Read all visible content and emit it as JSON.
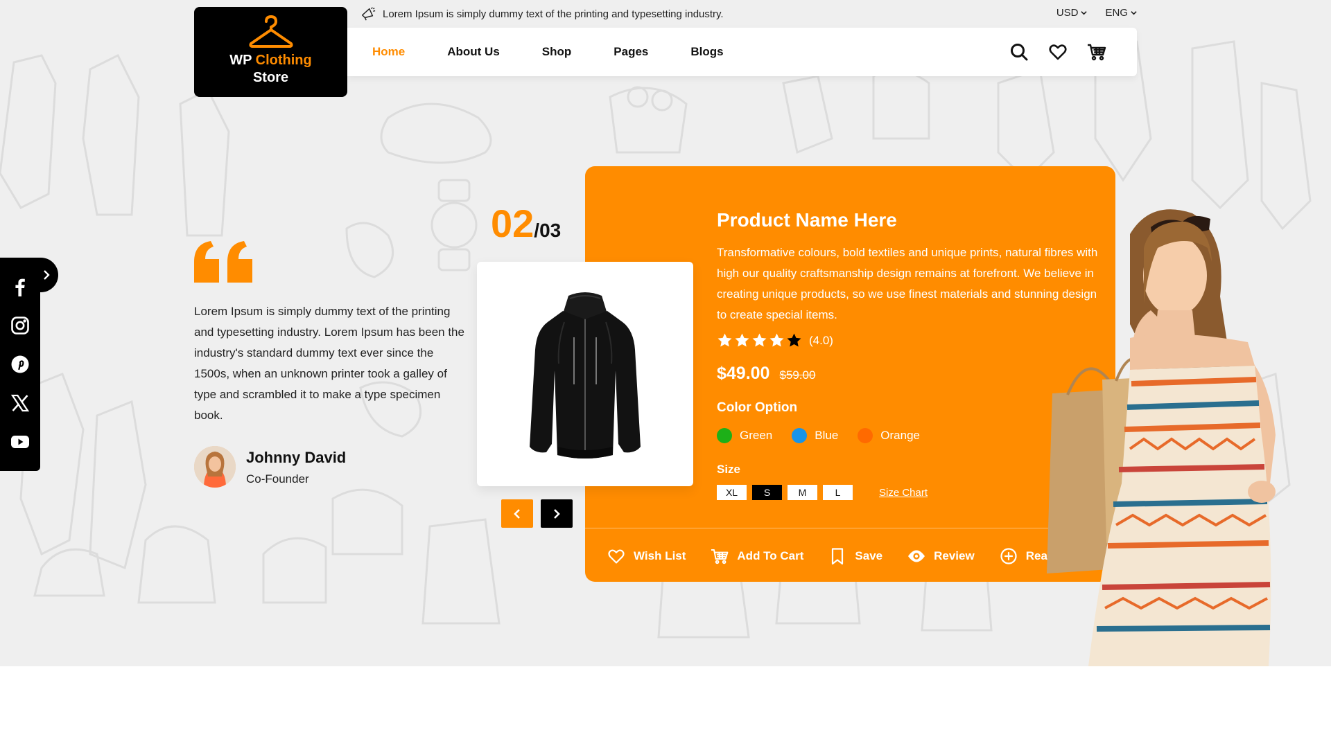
{
  "brand": {
    "line1_white": "WP",
    "line1_orange": "Clothing",
    "line2": "Store"
  },
  "topbar": {
    "announcement": "Lorem Ipsum is simply dummy text of the printing and typesetting industry.",
    "currency": "USD",
    "language": "ENG"
  },
  "nav": {
    "items": [
      {
        "label": "Home",
        "active": true
      },
      {
        "label": "About Us"
      },
      {
        "label": "Shop"
      },
      {
        "label": "Pages"
      },
      {
        "label": "Blogs"
      }
    ],
    "icons": [
      "search-icon",
      "heart-icon",
      "cart-icon"
    ]
  },
  "social": [
    "facebook-icon",
    "instagram-icon",
    "pinterest-icon",
    "x-icon",
    "youtube-icon"
  ],
  "testimonial": {
    "text": "Lorem Ipsum is simply dummy text of the printing and typesetting industry. Lorem Ipsum has been the industry's standard dummy text ever since the 1500s, when an unknown printer took a galley of type and scrambled it to make a type specimen book.",
    "author": "Johnny David",
    "role": "Co-Founder"
  },
  "slider": {
    "current": "02",
    "total": "/03"
  },
  "product": {
    "name": "Product Name Here",
    "description": "Transformative colours, bold textiles and unique prints, natural fibres with high our quality craftsmanship design remains at forefront. We believe in creating unique products, so we use finest materials and stunning design to create special items.",
    "rating": 4.0,
    "rating_label": "(4.0)",
    "price": "$49.00",
    "old_price": "$59.00",
    "color_title": "Color Option",
    "colors": [
      {
        "label": "Green",
        "hex": "#1db018"
      },
      {
        "label": "Blue",
        "hex": "#1894e8"
      },
      {
        "label": "Orange",
        "hex": "#ff6a00"
      }
    ],
    "size_title": "Size",
    "sizes": [
      {
        "label": "XL"
      },
      {
        "label": "S",
        "selected": true
      },
      {
        "label": "M"
      },
      {
        "label": "L"
      }
    ],
    "size_chart": "Size Chart",
    "actions": [
      {
        "label": "Wish List",
        "icon": "heart-icon"
      },
      {
        "label": "Add To Cart",
        "icon": "cart-icon"
      },
      {
        "label": "Save",
        "icon": "bookmark-icon"
      },
      {
        "label": "Review",
        "icon": "eye-icon"
      },
      {
        "label": "Read More",
        "icon": "plus-circle-icon"
      }
    ]
  },
  "colors": {
    "accent": "#ff8c00",
    "dark": "#000000",
    "bg": "#efefef"
  }
}
